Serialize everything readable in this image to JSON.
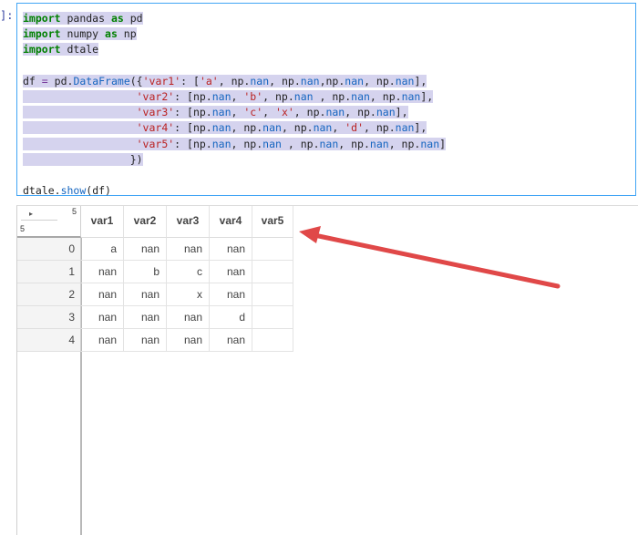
{
  "cell": {
    "prompt": "]:",
    "lines": [
      [
        {
          "t": "import",
          "c": "kw"
        },
        {
          "t": " pandas "
        },
        {
          "t": "as",
          "c": "kw"
        },
        {
          "t": " pd"
        }
      ],
      [
        {
          "t": "import",
          "c": "kw"
        },
        {
          "t": " numpy "
        },
        {
          "t": "as",
          "c": "kw"
        },
        {
          "t": " np"
        }
      ],
      [
        {
          "t": "import",
          "c": "kw"
        },
        {
          "t": " dtale"
        }
      ],
      [
        {
          "t": ""
        }
      ],
      [
        {
          "t": "df "
        },
        {
          "t": "=",
          "c": "op"
        },
        {
          "t": " pd"
        },
        {
          "t": "."
        },
        {
          "t": "DataFrame",
          "c": "fn"
        },
        {
          "t": "({"
        },
        {
          "t": "'var1'",
          "c": "str"
        },
        {
          "t": ": ["
        },
        {
          "t": "'a'",
          "c": "str"
        },
        {
          "t": ", np"
        },
        {
          "t": "."
        },
        {
          "t": "nan",
          "c": "fn"
        },
        {
          "t": ", np"
        },
        {
          "t": "."
        },
        {
          "t": "nan",
          "c": "fn"
        },
        {
          "t": ",np"
        },
        {
          "t": "."
        },
        {
          "t": "nan",
          "c": "fn"
        },
        {
          "t": ", np"
        },
        {
          "t": "."
        },
        {
          "t": "nan",
          "c": "fn"
        },
        {
          "t": "],"
        }
      ],
      [
        {
          "t": "                  "
        },
        {
          "t": "'var2'",
          "c": "str"
        },
        {
          "t": ": [np"
        },
        {
          "t": "."
        },
        {
          "t": "nan",
          "c": "fn"
        },
        {
          "t": ", "
        },
        {
          "t": "'b'",
          "c": "str"
        },
        {
          "t": ", np"
        },
        {
          "t": "."
        },
        {
          "t": "nan",
          "c": "fn"
        },
        {
          "t": " , np"
        },
        {
          "t": "."
        },
        {
          "t": "nan",
          "c": "fn"
        },
        {
          "t": ", np"
        },
        {
          "t": "."
        },
        {
          "t": "nan",
          "c": "fn"
        },
        {
          "t": "],"
        }
      ],
      [
        {
          "t": "                  "
        },
        {
          "t": "'var3'",
          "c": "str"
        },
        {
          "t": ": [np"
        },
        {
          "t": "."
        },
        {
          "t": "nan",
          "c": "fn"
        },
        {
          "t": ", "
        },
        {
          "t": "'c'",
          "c": "str"
        },
        {
          "t": ", "
        },
        {
          "t": "'x'",
          "c": "str"
        },
        {
          "t": ", np"
        },
        {
          "t": "."
        },
        {
          "t": "nan",
          "c": "fn"
        },
        {
          "t": ", np"
        },
        {
          "t": "."
        },
        {
          "t": "nan",
          "c": "fn"
        },
        {
          "t": "],"
        }
      ],
      [
        {
          "t": "                  "
        },
        {
          "t": "'var4'",
          "c": "str"
        },
        {
          "t": ": [np"
        },
        {
          "t": "."
        },
        {
          "t": "nan",
          "c": "fn"
        },
        {
          "t": ", np"
        },
        {
          "t": "."
        },
        {
          "t": "nan",
          "c": "fn"
        },
        {
          "t": ", np"
        },
        {
          "t": "."
        },
        {
          "t": "nan",
          "c": "fn"
        },
        {
          "t": ", "
        },
        {
          "t": "'d'",
          "c": "str"
        },
        {
          "t": ", np"
        },
        {
          "t": "."
        },
        {
          "t": "nan",
          "c": "fn"
        },
        {
          "t": "],"
        }
      ],
      [
        {
          "t": "                  "
        },
        {
          "t": "'var5'",
          "c": "str"
        },
        {
          "t": ": [np"
        },
        {
          "t": "."
        },
        {
          "t": "nan",
          "c": "fn"
        },
        {
          "t": ", np"
        },
        {
          "t": "."
        },
        {
          "t": "nan",
          "c": "fn"
        },
        {
          "t": " , np"
        },
        {
          "t": "."
        },
        {
          "t": "nan",
          "c": "fn"
        },
        {
          "t": ", np"
        },
        {
          "t": "."
        },
        {
          "t": "nan",
          "c": "fn"
        },
        {
          "t": ", np"
        },
        {
          "t": "."
        },
        {
          "t": "nan",
          "c": "fn"
        },
        {
          "t": "]"
        }
      ],
      [
        {
          "t": "                 })"
        }
      ],
      [
        {
          "t": ""
        }
      ],
      [
        {
          "t": "dtale"
        },
        {
          "t": "."
        },
        {
          "t": "show",
          "c": "fn"
        },
        {
          "t": "(df)"
        }
      ]
    ]
  },
  "grid": {
    "corner_arrow": "▸",
    "corner_top_count": "5",
    "corner_bottom_count": "5",
    "columns": [
      "var1",
      "var2",
      "var3",
      "var4",
      "var5"
    ],
    "rows": [
      {
        "index": "0",
        "cells": [
          "a",
          "nan",
          "nan",
          "nan",
          ""
        ]
      },
      {
        "index": "1",
        "cells": [
          "nan",
          "b",
          "c",
          "nan",
          ""
        ]
      },
      {
        "index": "2",
        "cells": [
          "nan",
          "nan",
          "x",
          "nan",
          ""
        ]
      },
      {
        "index": "3",
        "cells": [
          "nan",
          "nan",
          "nan",
          "d",
          ""
        ]
      },
      {
        "index": "4",
        "cells": [
          "nan",
          "nan",
          "nan",
          "nan",
          ""
        ]
      }
    ]
  },
  "colors": {
    "selection": "#d5d3ee",
    "cell_border": "#42a5f5",
    "annotation_arrow": "#e04848"
  }
}
